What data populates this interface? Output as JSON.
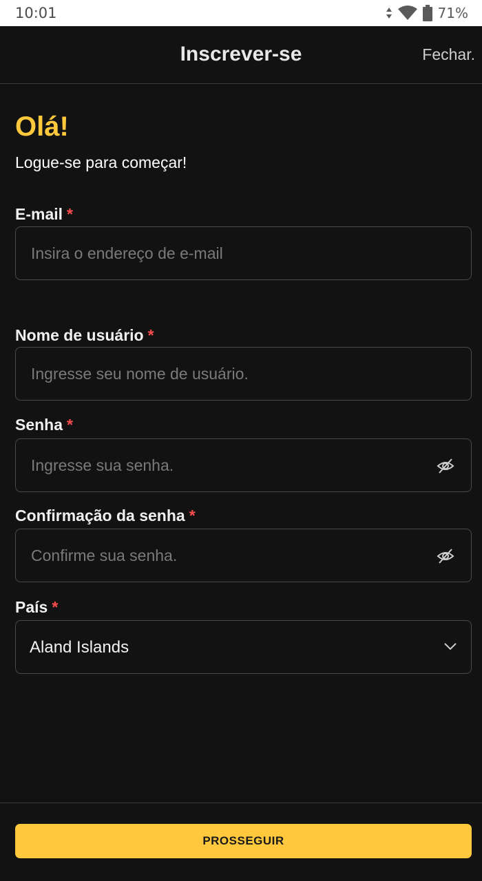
{
  "status_bar": {
    "time": "10:01",
    "battery": "71%",
    "icons": [
      "data-arrows-icon",
      "wifi-icon",
      "battery-icon"
    ]
  },
  "header": {
    "title": "Inscrever-se",
    "close_label": "Fechar."
  },
  "greeting": {
    "title": "Olá!",
    "subtitle": "Logue-se para começar!"
  },
  "form": {
    "email": {
      "label": "E-mail",
      "required": "*",
      "placeholder": "Insira o endereço de e-mail",
      "value": ""
    },
    "username": {
      "label": "Nome de usuário",
      "required": "*",
      "placeholder": "Ingresse seu nome de usuário.",
      "value": ""
    },
    "password": {
      "label": "Senha",
      "required": "*",
      "placeholder": "Ingresse sua senha.",
      "value": ""
    },
    "password_confirm": {
      "label": "Confirmação da senha",
      "required": "*",
      "placeholder": "Confirme sua senha.",
      "value": ""
    },
    "country": {
      "label": "País",
      "required": "*",
      "selected": "Aland Islands"
    }
  },
  "footer": {
    "continue_label": "PROSSEGUIR"
  },
  "colors": {
    "accent": "#ffc83d",
    "background": "#121212",
    "required": "#ff4d4d",
    "border": "#4a4a4a"
  }
}
